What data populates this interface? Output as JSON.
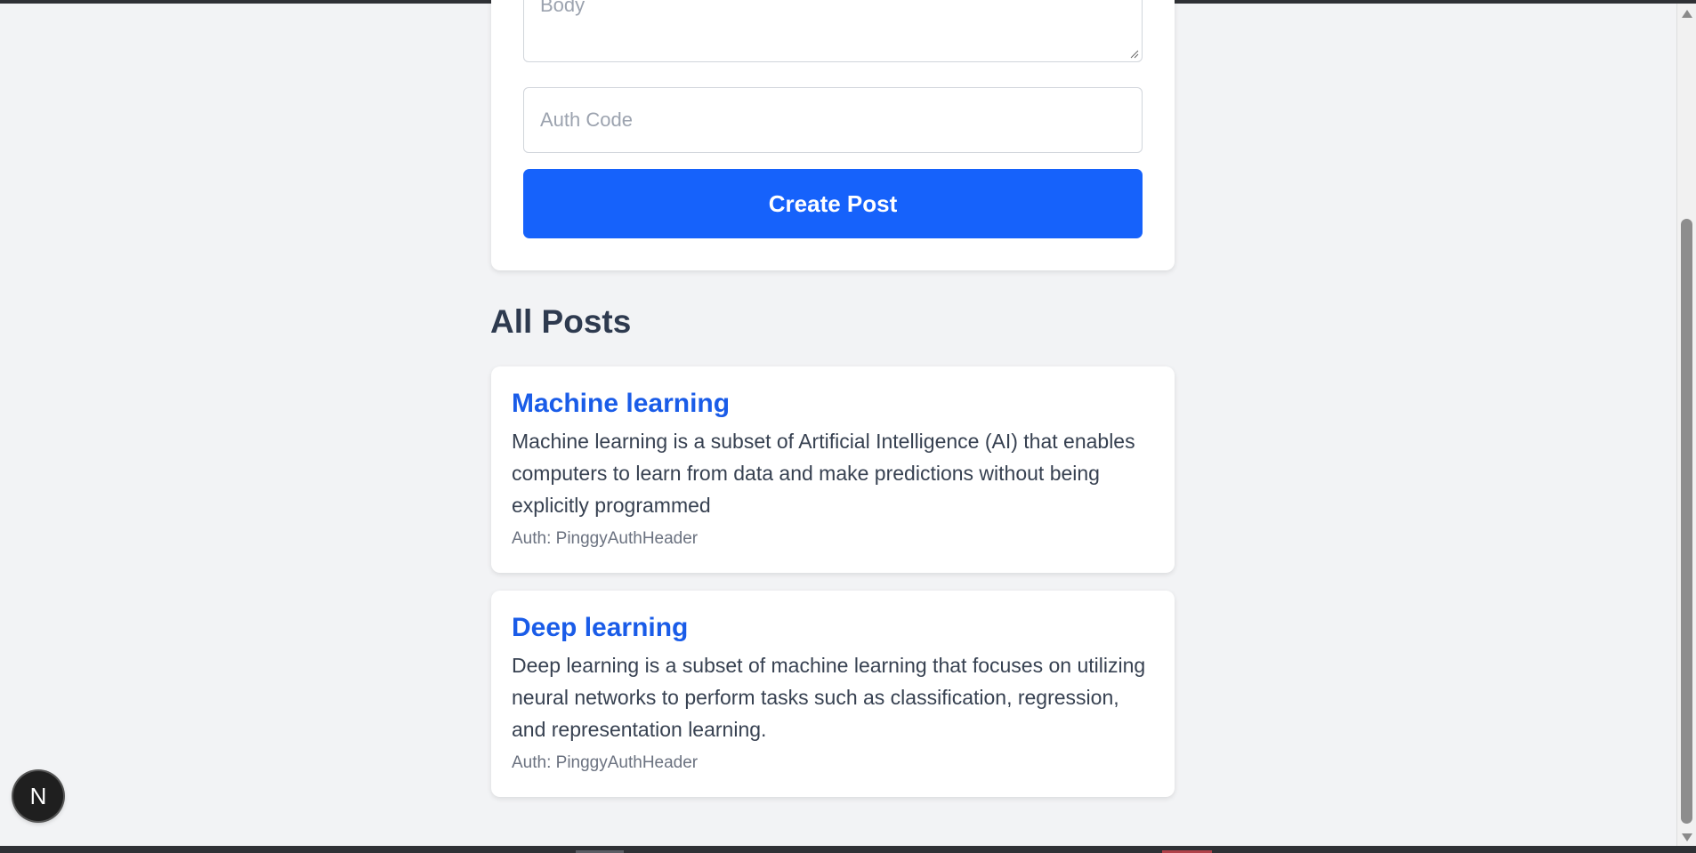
{
  "create_post": {
    "body_placeholder": "Body",
    "auth_placeholder": "Auth Code",
    "submit_label": "Create Post"
  },
  "posts_section": {
    "title": "All Posts",
    "posts": [
      {
        "title": "Machine learning",
        "body": "Machine learning is a subset of Artificial Intelligence (AI) that enables computers to learn from data and make predictions without being explicitly programmed",
        "auth": "Auth: PinggyAuthHeader"
      },
      {
        "title": "Deep learning",
        "body": "Deep learning is a subset of machine learning that focuses on utilizing neural networks to perform tasks such as classification, regression, and representation learning.",
        "auth": "Auth: PinggyAuthHeader"
      }
    ]
  },
  "dev_badge": {
    "letter": "N"
  },
  "colors": {
    "primary": "#1662fb",
    "post_title": "#1a5ce8",
    "page_background": "#f2f3f5"
  }
}
